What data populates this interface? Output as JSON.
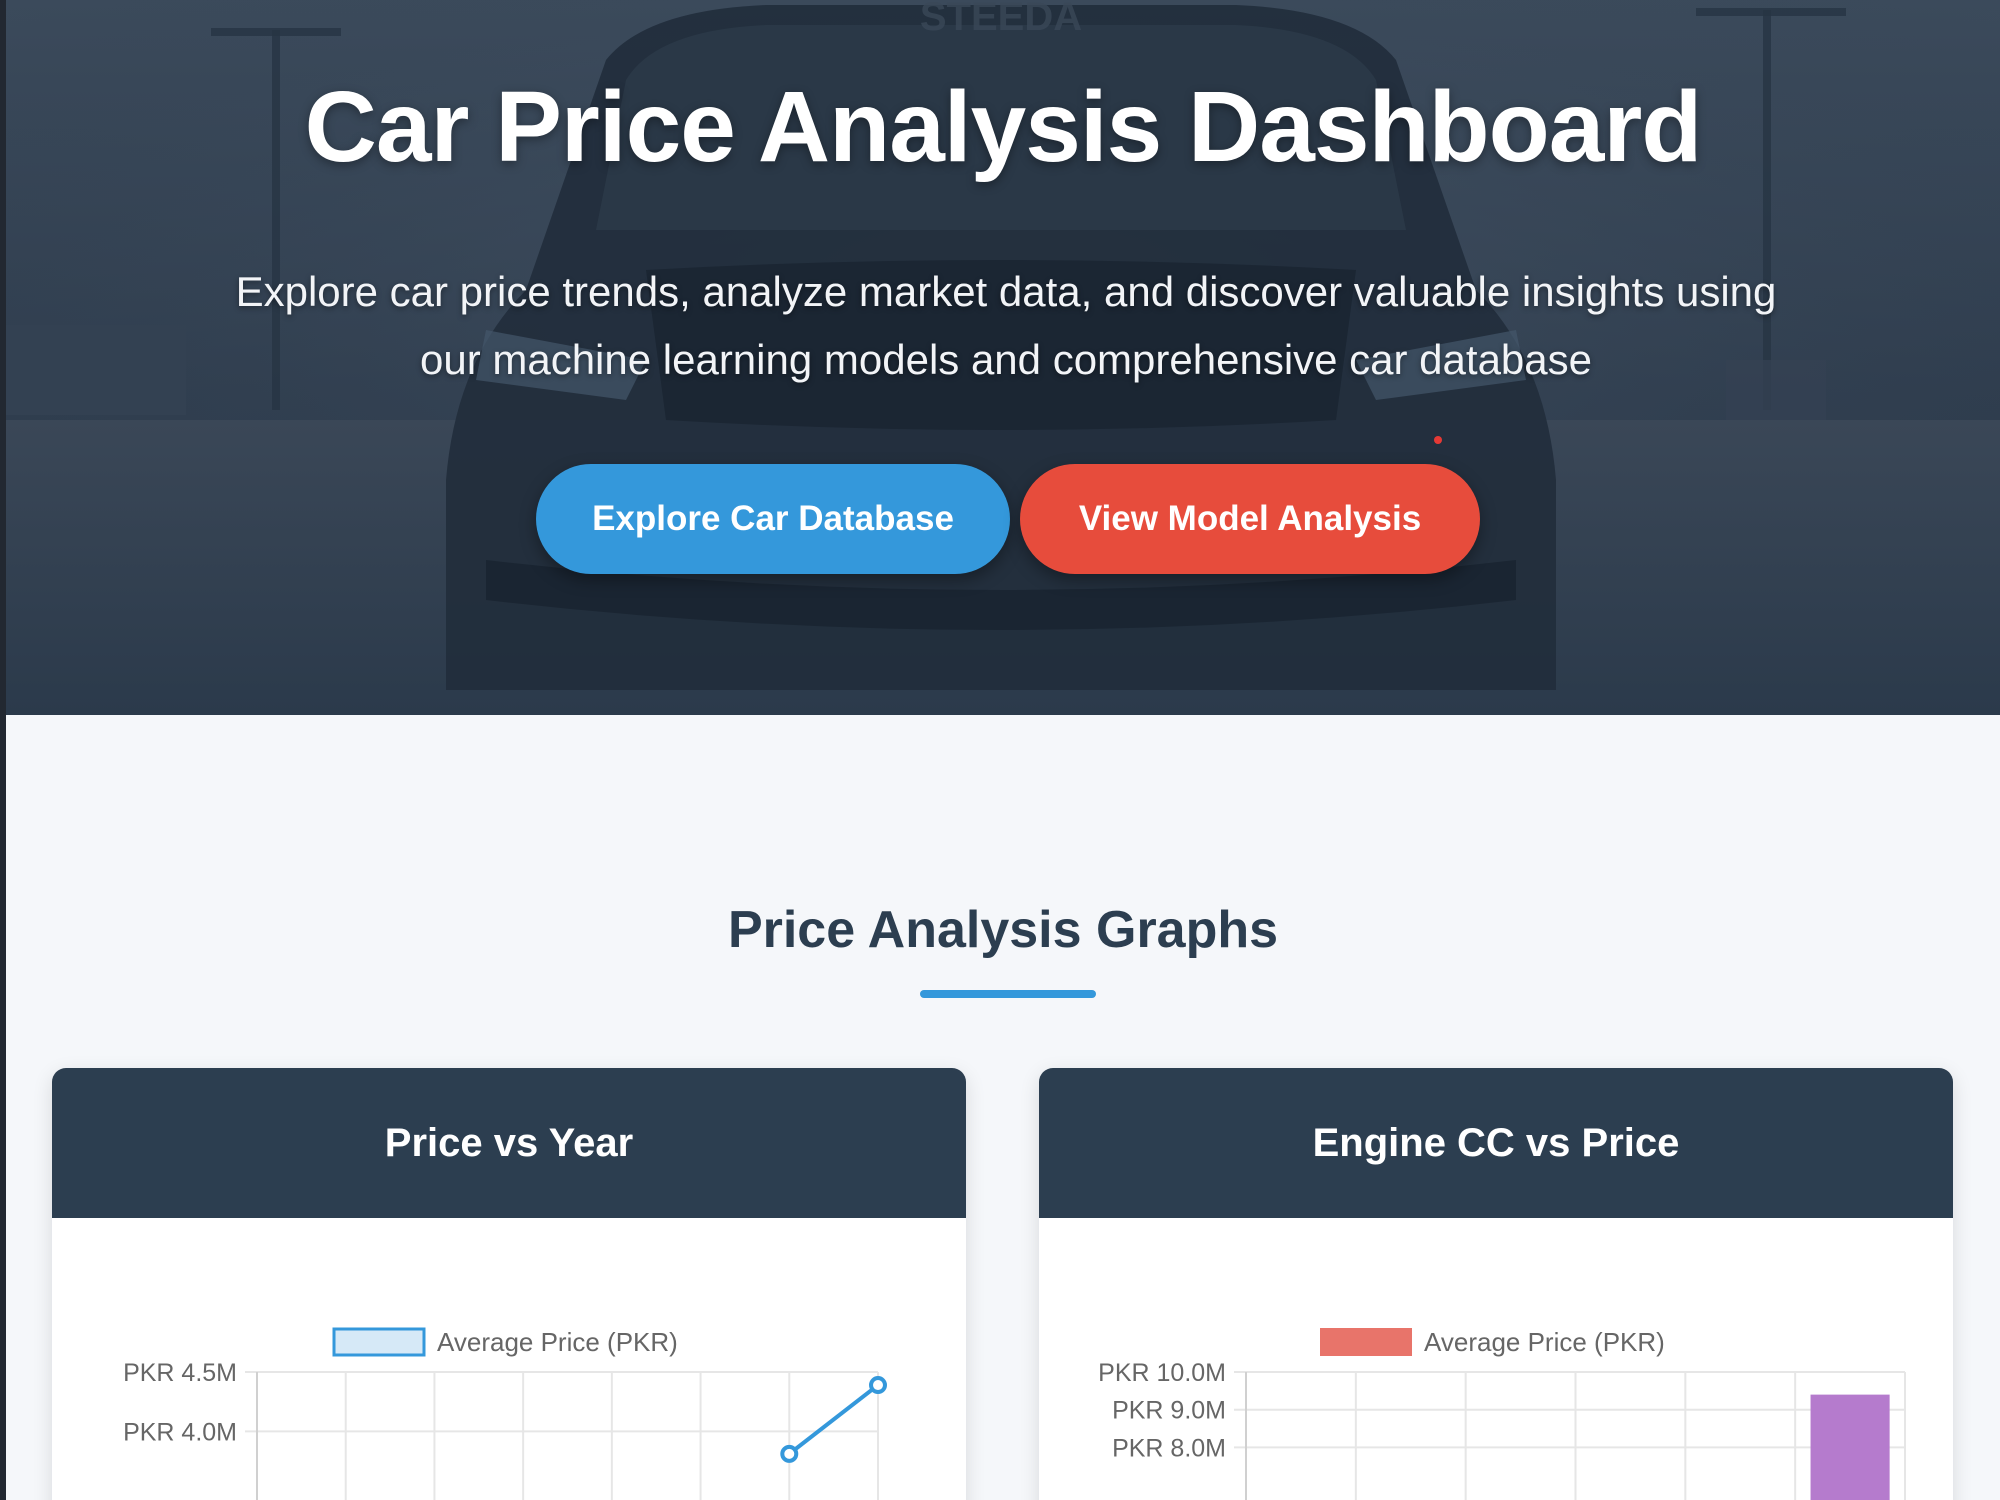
{
  "hero": {
    "title": "Car Price Analysis Dashboard",
    "subtitle": "Explore car price trends, analyze market data, and discover valuable insights using our machine learning models and comprehensive car database",
    "primary_button": "Explore Car Database",
    "secondary_button": "View Model Analysis",
    "colors": {
      "primary": "#3498db",
      "secondary": "#e74c3c",
      "dark": "#2c3e50"
    }
  },
  "section": {
    "title": "Price Analysis Graphs"
  },
  "cards": {
    "left_title": "Price vs Year",
    "right_title": "Engine CC vs Price"
  },
  "chart_data": [
    {
      "type": "line",
      "title": "Price vs Year",
      "legend": "Average Price (PKR)",
      "series": [
        {
          "name": "Average Price (PKR)",
          "color": "#3498db",
          "values": [
            null,
            null,
            null,
            null,
            null,
            null,
            3.81,
            4.39
          ]
        }
      ],
      "y_tick_labels": [
        "PKR 4.5M",
        "PKR 4.0M"
      ],
      "y_ticks": [
        4.5,
        4.0
      ],
      "ylim_visible": [
        3.75,
        4.5
      ],
      "grid": true,
      "legend_placement": "top"
    },
    {
      "type": "bar",
      "title": "Engine CC vs Price",
      "legend": "Average Price (PKR)",
      "series": [
        {
          "name": "Average Price (PKR)",
          "color": "#e8746a",
          "values": [
            null,
            null,
            null,
            null,
            null,
            9.4
          ]
        }
      ],
      "bar_color": "#b57bcd",
      "y_tick_labels": [
        "PKR 10.0M",
        "PKR 9.0M",
        "PKR 8.0M"
      ],
      "y_ticks": [
        10.0,
        9.0,
        8.0
      ],
      "ylim_visible": [
        7.4,
        10.0
      ],
      "grid": true,
      "legend_placement": "top"
    }
  ]
}
